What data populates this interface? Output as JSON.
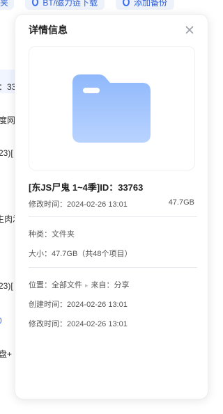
{
  "background": {
    "toolbar": [
      {
        "label": "夹"
      },
      {
        "label": "BT/磁力链下载"
      },
      {
        "label": "添加备份"
      }
    ],
    "rows": [
      {
        "text": "：33"
      },
      {
        "text": "度网"
      },
      {
        "text": "23)["
      },
      {
        "text": "生肉孞"
      },
      {
        "text": "23)["
      },
      {
        "text": "0"
      },
      {
        "text": "盘+"
      }
    ]
  },
  "panel": {
    "title": "详情信息",
    "file_name": "[东JS尸鬼 1~4季]ID：33763",
    "modified_top": "修改时间：2024-02-26 13:01",
    "size_top": "47.7GB",
    "type": "种类：文件夹",
    "size": "大小：47.7GB（共48个项目）",
    "location_label": "位置：",
    "location_value": "全部文件",
    "source_label": "来自：",
    "source_value": "分享",
    "created": "创建时间：2024-02-26 13:01",
    "modified": "修改时间：2024-02-26 13:01"
  },
  "colors": {
    "folder_top": "#8fb8fb",
    "folder_bottom": "#b9d3ff",
    "accent": "#3b6ef5"
  }
}
